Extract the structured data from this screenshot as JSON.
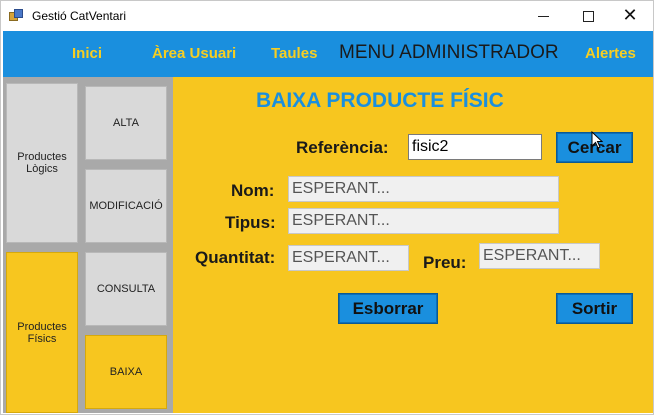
{
  "window": {
    "title": "Gestió CatVentari",
    "minimize_icon": "minimize-icon",
    "maximize_icon": "maximize-icon",
    "close_icon": "close-icon",
    "close_glyph": "✕"
  },
  "menubar": {
    "items": [
      "Inici",
      "Àrea Usuari",
      "Taules",
      "Alertes"
    ],
    "admin_label": "MENU ADMINISTRADOR"
  },
  "sidebar": {
    "categories": [
      {
        "label_line1": "Productes",
        "label_line2": "Lògics"
      },
      {
        "label_line1": "Productes",
        "label_line2": "Físics"
      }
    ],
    "actions": [
      "ALTA",
      "MODIFICACIÓ",
      "CONSULTA",
      "BAIXA"
    ]
  },
  "form": {
    "title": "BAIXA PRODUCTE FÍSIC",
    "referencia_label": "Referència:",
    "referencia_value": "fisic2",
    "search_button": "Cercar",
    "nom_label": "Nom:",
    "nom_value": "ESPERANT...",
    "tipus_label": "Tipus:",
    "tipus_value": "ESPERANT...",
    "quantitat_label": "Quantitat:",
    "quantitat_value": "ESPERANT...",
    "preu_label": "Preu:",
    "preu_value": "ESPERANT...",
    "delete_button": "Esborrar",
    "exit_button": "Sortir"
  },
  "colors": {
    "accent_blue": "#1a8fde",
    "accent_yellow": "#f7c61f",
    "panel_gray": "#a9a9a9",
    "button_gray": "#d9d9d9"
  }
}
